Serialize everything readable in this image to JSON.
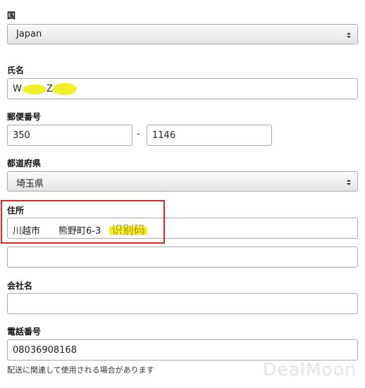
{
  "country": {
    "label": "国",
    "value": "Japan"
  },
  "name": {
    "label": "氏名",
    "value_first": "W",
    "value_second": "Z"
  },
  "postal": {
    "label": "郵便番号",
    "part1": "350",
    "separator": "-",
    "part2": "1146"
  },
  "prefecture": {
    "label": "都道府県",
    "value": "埼玉県"
  },
  "address": {
    "label": "住所",
    "line1": "川越市　　熊野町6-3",
    "line2": "",
    "annotation": "识别码"
  },
  "company": {
    "label": "会社名",
    "value": ""
  },
  "phone": {
    "label": "電話番号",
    "value": "08036908168",
    "note": "配送に関連して使用される場合があります"
  },
  "watermark": "DealMoon",
  "colors": {
    "highlight_box": "#d9262e",
    "redaction": "#f2f02a"
  }
}
